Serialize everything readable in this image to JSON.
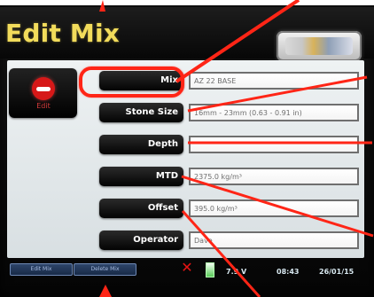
{
  "screen": {
    "title": "Edit Mix",
    "edit_button_label": "Edit"
  },
  "fields": [
    {
      "label": "Mix",
      "value": "AZ 22 BASE"
    },
    {
      "label": "Stone Size",
      "value": "16mm - 23mm (0.63 - 0.91 in)"
    },
    {
      "label": "Depth",
      "value": ""
    },
    {
      "label": "MTD",
      "value": "2375.0 kg/m³"
    },
    {
      "label": "Offset",
      "value": "395.0 kg/m³"
    },
    {
      "label": "Operator",
      "value": "Dave"
    }
  ],
  "footer": {
    "left_buttons": [
      "Edit Mix",
      "Delete Mix"
    ],
    "status": {
      "value": "7.9 V",
      "time": "08:43",
      "date": "26/01/15"
    }
  },
  "icons": {
    "edit": "edit-icon",
    "logo": "brand-logo",
    "warning": "warning-icon",
    "battery": "battery-icon"
  },
  "colors": {
    "title": "#f2dc5b",
    "annotation": "#ff2516",
    "button": "#111111",
    "field_border": "#6f6f6f"
  }
}
